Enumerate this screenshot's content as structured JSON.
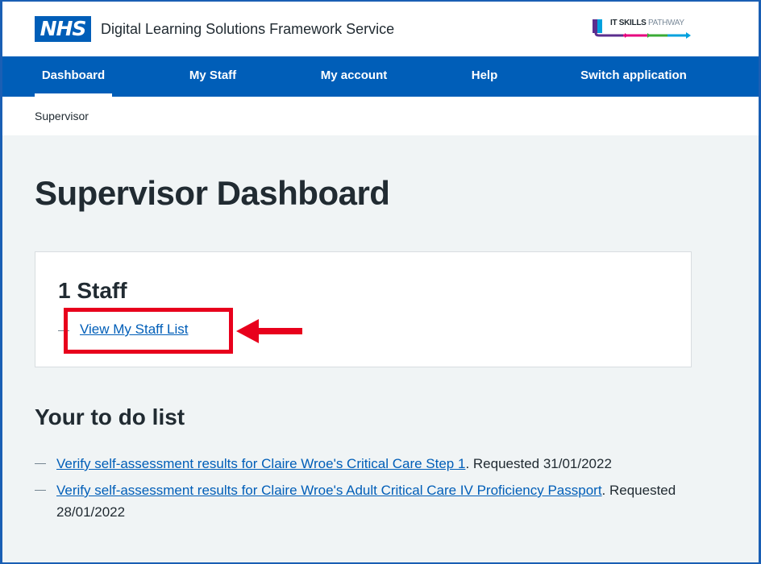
{
  "header": {
    "logo_text": "NHS",
    "service_name": "Digital Learning Solutions Framework Service",
    "pathway_logo": {
      "bold": "IT SKILLS",
      "thin": "PATHWAY"
    }
  },
  "nav": {
    "items": [
      {
        "label": "Dashboard",
        "active": true
      },
      {
        "label": "My Staff",
        "active": false
      },
      {
        "label": "My account",
        "active": false
      },
      {
        "label": "Help",
        "active": false
      },
      {
        "label": "Switch application",
        "active": false
      }
    ]
  },
  "breadcrumb": "Supervisor",
  "main": {
    "title": "Supervisor Dashboard",
    "staff_card": {
      "heading": "1 Staff",
      "link": "View My Staff List"
    },
    "todo": {
      "title": "Your to do list",
      "items": [
        {
          "link": "Verify self-assessment results for Claire Wroe's Critical Care Step 1",
          "suffix": ". Requested 31/01/2022"
        },
        {
          "link": "Verify self-assessment results for Claire Wroe's Adult Critical Care IV Proficiency Passport",
          "suffix": ". Requested 28/01/2022"
        }
      ]
    }
  },
  "colors": {
    "nhs_blue": "#005eb8",
    "annotation_red": "#e8001c",
    "text": "#212b32",
    "background": "#f0f4f5"
  },
  "icons": [
    "nhs-logo",
    "it-skills-pathway-logo",
    "annotation-arrow-icon"
  ]
}
